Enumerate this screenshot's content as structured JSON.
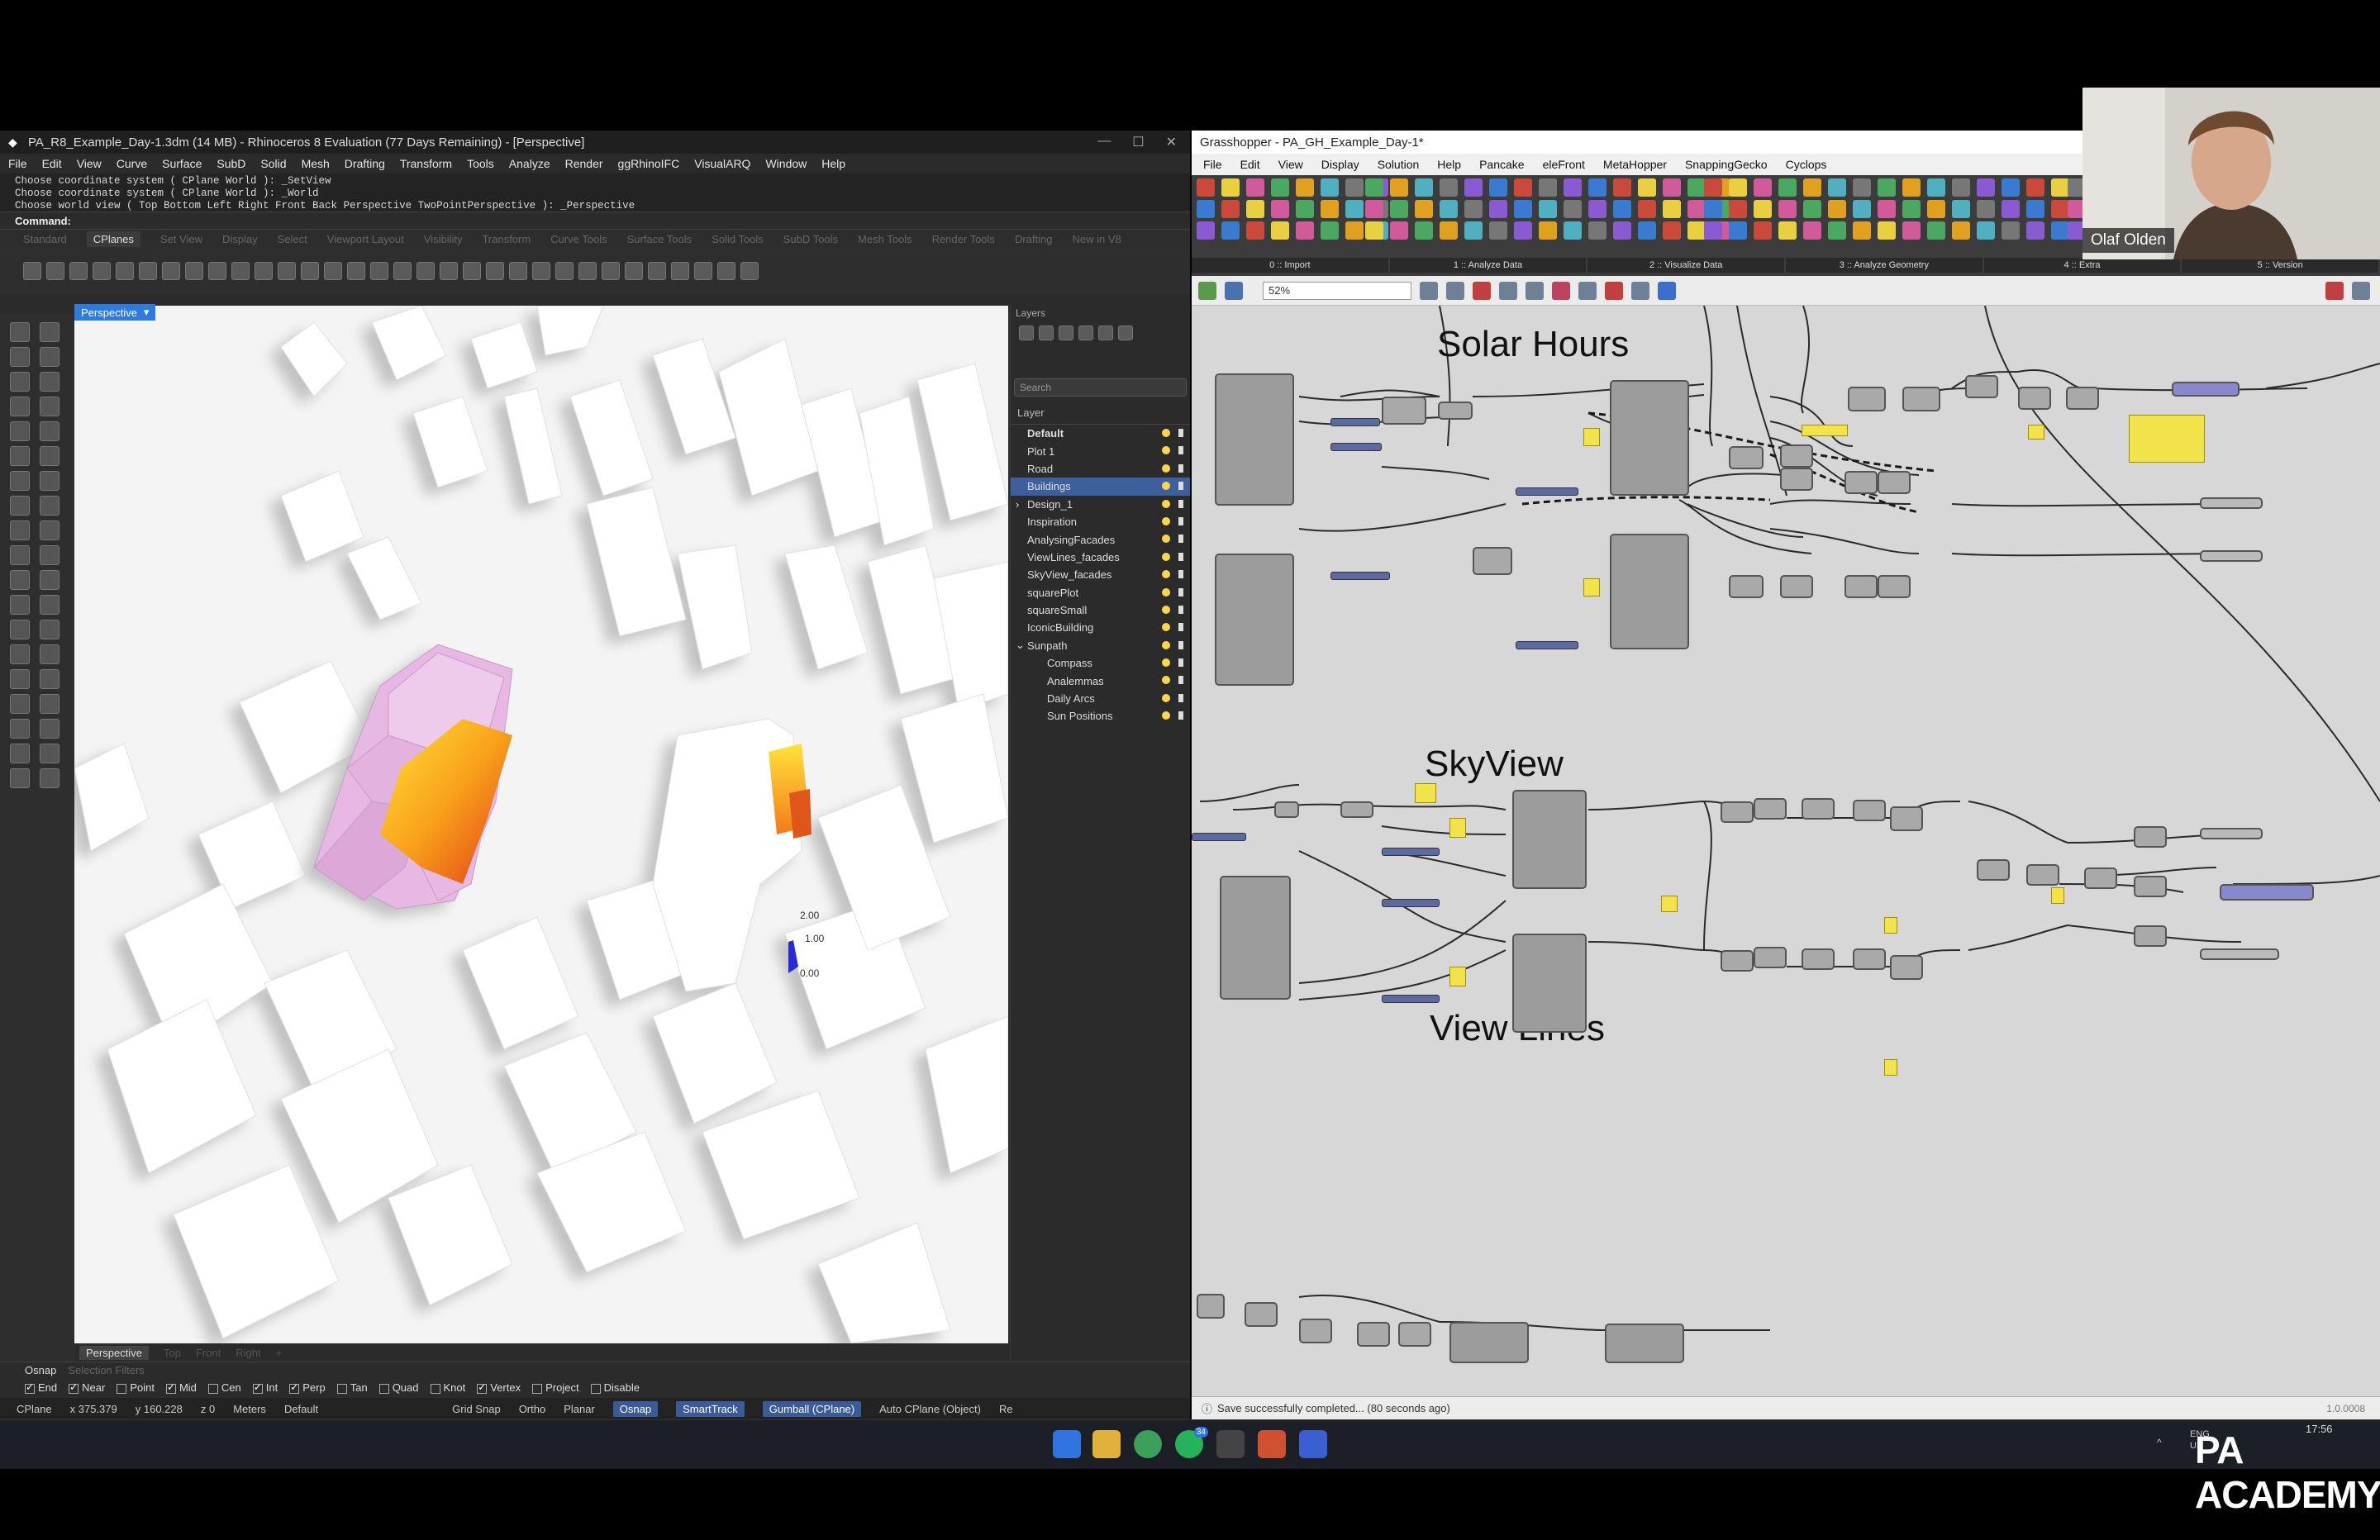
{
  "rhino": {
    "title": "PA_R8_Example_Day-1.3dm (14 MB) - Rhinoceros 8 Evaluation (77 Days Remaining) - [Perspective]",
    "menu": [
      "File",
      "Edit",
      "View",
      "Curve",
      "Surface",
      "SubD",
      "Solid",
      "Mesh",
      "Drafting",
      "Transform",
      "Tools",
      "Analyze",
      "Render",
      "ggRhinoIFC",
      "VisualARQ",
      "Window",
      "Help"
    ],
    "history": [
      "Choose coordinate system ( CPlane World ): _SetView",
      "Choose coordinate system ( CPlane World ): _World",
      "Choose world view ( Top Bottom Left Right Front Back Perspective TwoPointPerspective ): _Perspective"
    ],
    "command_label": "Command:",
    "toolbar_tabs": [
      "Standard",
      "CPlanes",
      "Set View",
      "Display",
      "Select",
      "Viewport Layout",
      "Visibility",
      "Transform",
      "Curve Tools",
      "Surface Tools",
      "Solid Tools",
      "SubD Tools",
      "Mesh Tools",
      "Render Tools",
      "Drafting",
      "New in V8"
    ],
    "active_tab": "CPlanes",
    "viewport_label": "Perspective",
    "bottom_tabs": [
      "Perspective",
      "Top",
      "Front",
      "Right",
      "+"
    ],
    "legend_values": [
      "2.00",
      "1.00",
      "0.00"
    ],
    "layers": {
      "panel_title": "Layers",
      "search_placeholder": "Search",
      "column": "Layer",
      "items": [
        {
          "name": "Default",
          "bold": true,
          "indent": 0
        },
        {
          "name": "Plot 1",
          "indent": 0
        },
        {
          "name": "Road",
          "indent": 0
        },
        {
          "name": "Buildings",
          "indent": 0,
          "selected": true
        },
        {
          "name": "Design_1",
          "indent": 0,
          "expand": "›"
        },
        {
          "name": "Inspiration",
          "indent": 0
        },
        {
          "name": "AnalysingFacades",
          "indent": 0
        },
        {
          "name": "ViewLines_facades",
          "indent": 0
        },
        {
          "name": "SkyView_facades",
          "indent": 0
        },
        {
          "name": "squarePlot",
          "indent": 0
        },
        {
          "name": "squareSmall",
          "indent": 0
        },
        {
          "name": "IconicBuilding",
          "indent": 0
        },
        {
          "name": "Sunpath",
          "indent": 0,
          "expand": "⌄"
        },
        {
          "name": "Compass",
          "indent": 1
        },
        {
          "name": "Analemmas",
          "indent": 1
        },
        {
          "name": "Daily Arcs",
          "indent": 1
        },
        {
          "name": "Sun Positions",
          "indent": 1
        }
      ]
    },
    "osnap_tabs": [
      "Osnap",
      "Selection Filters"
    ],
    "osnap_items": [
      {
        "label": "End",
        "on": true
      },
      {
        "label": "Near",
        "on": true
      },
      {
        "label": "Point",
        "on": false
      },
      {
        "label": "Mid",
        "on": true
      },
      {
        "label": "Cen",
        "on": false
      },
      {
        "label": "Int",
        "on": true
      },
      {
        "label": "Perp",
        "on": true
      },
      {
        "label": "Tan",
        "on": false
      },
      {
        "label": "Quad",
        "on": false
      },
      {
        "label": "Knot",
        "on": false
      },
      {
        "label": "Vertex",
        "on": true
      },
      {
        "label": "Project",
        "on": false
      },
      {
        "label": "Disable",
        "on": false
      }
    ],
    "status": {
      "cplane": "CPlane",
      "x": "x 375.379",
      "y": "y 160.228",
      "z": "z 0",
      "units": "Meters",
      "layer": "Default",
      "grid_snap": "Grid Snap",
      "ortho": "Ortho",
      "planar": "Planar",
      "osnap": "Osnap",
      "smarttrack": "SmartTrack",
      "gumball": "Gumball (CPlane)",
      "auto_cplane": "Auto CPlane (Object)",
      "rec": "Re"
    }
  },
  "grasshopper": {
    "title": "Grasshopper - PA_GH_Example_Day-1*",
    "menu": [
      "File",
      "Edit",
      "View",
      "Display",
      "Solution",
      "Help",
      "Pancake",
      "eleFront",
      "MetaHopper",
      "SnappingGecko",
      "Cyclops"
    ],
    "ribbon_groups": [
      "0 :: Import",
      "1 :: Analyze Data",
      "2 :: Visualize Data",
      "3 :: Analyze Geometry",
      "4 :: Extra",
      "5 :: Version"
    ],
    "zoom": "52%",
    "groups": [
      "Solar Hours",
      "SkyView",
      "View Lines"
    ],
    "status": "Save successfully completed... (80 seconds ago)",
    "version": "1.0.0008"
  },
  "webcam": {
    "name": "Olaf Olden"
  },
  "taskbar": {
    "lang_top": "ENG",
    "lang_bottom": "US",
    "time": "17:56",
    "date": "",
    "badge": "34"
  },
  "brand": {
    "text": "PA ACADEMY"
  },
  "colors": {
    "viewport_bg": "#f4f4f4",
    "building": "#ffffff",
    "design": "#e7b8e3",
    "accent": "#3d5f9c",
    "panel_yellow": "#f3e34b",
    "heat_high": "#e03b1a",
    "heat_low": "#ffe23b"
  }
}
